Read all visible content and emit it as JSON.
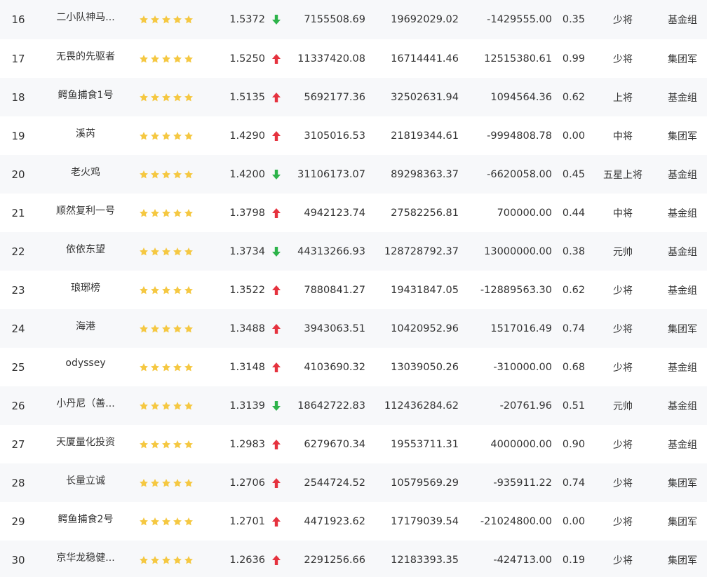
{
  "colors": {
    "star": "#f5c842",
    "up": "#e5323e",
    "down": "#2db34a",
    "row_alt": "#f7f8fa",
    "text": "#333333"
  },
  "rows": [
    {
      "rank": "16",
      "name": "二小队神马...",
      "stars": 5,
      "nav": "1.5372",
      "trend": "down",
      "v1": "7155508.69",
      "v2": "19692029.02",
      "v3": "-1429555.00",
      "ratio": "0.35",
      "title": "少将",
      "group": "基金组"
    },
    {
      "rank": "17",
      "name": "无畏的先驱者",
      "stars": 5,
      "nav": "1.5250",
      "trend": "up",
      "v1": "11337420.08",
      "v2": "16714441.46",
      "v3": "12515380.61",
      "ratio": "0.99",
      "title": "少将",
      "group": "集团军"
    },
    {
      "rank": "18",
      "name": "鳄鱼捕食1号",
      "stars": 5,
      "nav": "1.5135",
      "trend": "up",
      "v1": "5692177.36",
      "v2": "32502631.94",
      "v3": "1094564.36",
      "ratio": "0.62",
      "title": "上将",
      "group": "基金组"
    },
    {
      "rank": "19",
      "name": "溪芮",
      "stars": 5,
      "nav": "1.4290",
      "trend": "up",
      "v1": "3105016.53",
      "v2": "21819344.61",
      "v3": "-9994808.78",
      "ratio": "0.00",
      "title": "中将",
      "group": "集团军"
    },
    {
      "rank": "20",
      "name": "老火鸡",
      "stars": 5,
      "nav": "1.4200",
      "trend": "down",
      "v1": "31106173.07",
      "v2": "89298363.37",
      "v3": "-6620058.00",
      "ratio": "0.45",
      "title": "五星上将",
      "group": "基金组"
    },
    {
      "rank": "21",
      "name": "顺然复利一号",
      "stars": 5,
      "nav": "1.3798",
      "trend": "up",
      "v1": "4942123.74",
      "v2": "27582256.81",
      "v3": "700000.00",
      "ratio": "0.44",
      "title": "中将",
      "group": "基金组"
    },
    {
      "rank": "22",
      "name": "依依东望",
      "stars": 5,
      "nav": "1.3734",
      "trend": "down",
      "v1": "44313266.93",
      "v2": "128728792.37",
      "v3": "13000000.00",
      "ratio": "0.38",
      "title": "元帅",
      "group": "基金组"
    },
    {
      "rank": "23",
      "name": "琅琊榜",
      "stars": 5,
      "nav": "1.3522",
      "trend": "up",
      "v1": "7880841.27",
      "v2": "19431847.05",
      "v3": "-12889563.30",
      "ratio": "0.62",
      "title": "少将",
      "group": "基金组"
    },
    {
      "rank": "24",
      "name": "海港",
      "stars": 5,
      "nav": "1.3488",
      "trend": "up",
      "v1": "3943063.51",
      "v2": "10420952.96",
      "v3": "1517016.49",
      "ratio": "0.74",
      "title": "少将",
      "group": "集团军"
    },
    {
      "rank": "25",
      "name": "odyssey",
      "stars": 5,
      "nav": "1.3148",
      "trend": "up",
      "v1": "4103690.32",
      "v2": "13039050.26",
      "v3": "-310000.00",
      "ratio": "0.68",
      "title": "少将",
      "group": "基金组"
    },
    {
      "rank": "26",
      "name": "小丹尼（善...",
      "stars": 5,
      "nav": "1.3139",
      "trend": "down",
      "v1": "18642722.83",
      "v2": "112436284.62",
      "v3": "-20761.96",
      "ratio": "0.51",
      "title": "元帅",
      "group": "基金组"
    },
    {
      "rank": "27",
      "name": "天厦量化投资",
      "stars": 5,
      "nav": "1.2983",
      "trend": "up",
      "v1": "6279670.34",
      "v2": "19553711.31",
      "v3": "4000000.00",
      "ratio": "0.90",
      "title": "少将",
      "group": "基金组"
    },
    {
      "rank": "28",
      "name": "长量立诚",
      "stars": 5,
      "nav": "1.2706",
      "trend": "up",
      "v1": "2544724.52",
      "v2": "10579569.29",
      "v3": "-935911.22",
      "ratio": "0.74",
      "title": "少将",
      "group": "集团军"
    },
    {
      "rank": "29",
      "name": "鳄鱼捕食2号",
      "stars": 5,
      "nav": "1.2701",
      "trend": "up",
      "v1": "4471923.62",
      "v2": "17179039.54",
      "v3": "-21024800.00",
      "ratio": "0.00",
      "title": "少将",
      "group": "集团军"
    },
    {
      "rank": "30",
      "name": "京华龙稳健...",
      "stars": 5,
      "nav": "1.2636",
      "trend": "up",
      "v1": "2291256.66",
      "v2": "12183393.35",
      "v3": "-424713.00",
      "ratio": "0.19",
      "title": "少将",
      "group": "集团军"
    }
  ]
}
